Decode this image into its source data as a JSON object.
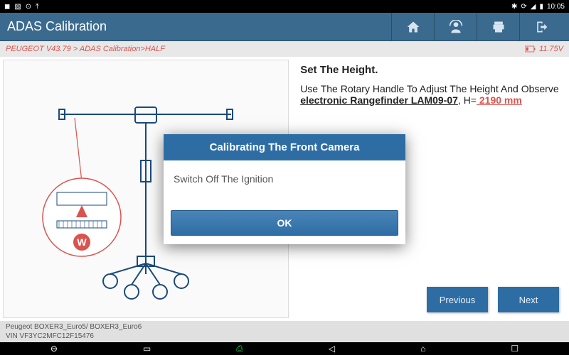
{
  "statusbar": {
    "time": "10:05"
  },
  "header": {
    "title": "ADAS Calibration"
  },
  "breadcrumb": {
    "path": "PEUGEOT V43.79 > ADAS Calibration>HALF",
    "voltage": "11.75V"
  },
  "instruction": {
    "heading": "Set The Height.",
    "text1": "Use The Rotary Handle To Adjust The Height And Observe ",
    "link": "electronic Rangefinder LAM09-07",
    "text2": ", H=",
    "value": " 2190 mm"
  },
  "nav": {
    "prev": "Previous",
    "next": "Next"
  },
  "footer": {
    "line1": "Peugeot BOXER3_Euro5/ BOXER3_Euro6",
    "line2": "VIN VF3YC2MFC12F15476"
  },
  "modal": {
    "title": "Calibrating The Front Camera",
    "body": "Switch Off The Ignition",
    "ok": "OK"
  }
}
